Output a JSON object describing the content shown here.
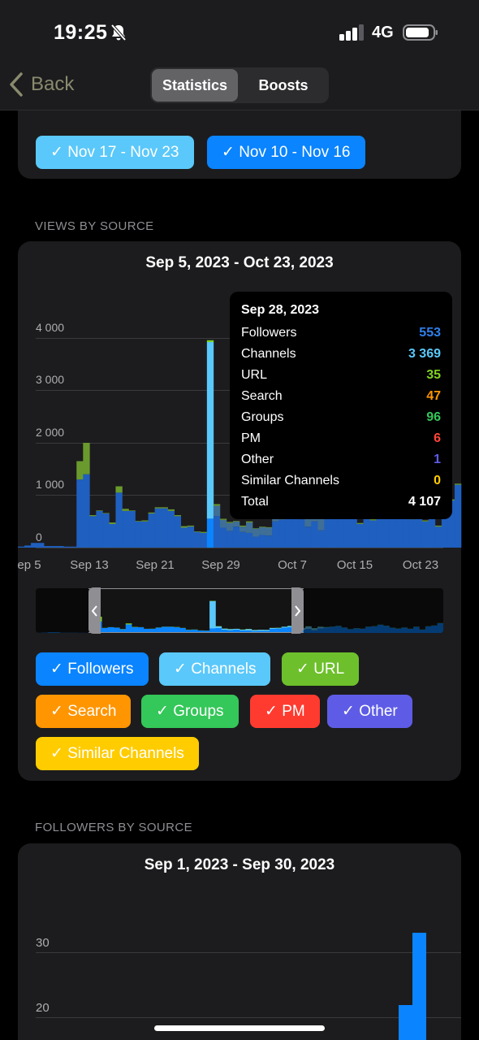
{
  "status": {
    "time": "19:25",
    "network": "4G"
  },
  "nav": {
    "back_label": "Back",
    "tabs": [
      "Statistics",
      "Boosts"
    ]
  },
  "period_chips": [
    {
      "label": "✓ Nov 17 - Nov 23",
      "color": "#5ac8fa"
    },
    {
      "label": "✓ Nov 10 - Nov 16",
      "color": "#0a84ff"
    }
  ],
  "views_section": {
    "title": "VIEWS BY SOURCE",
    "range": "Sep 5, 2023 - Oct 23, 2023",
    "y_ticks": [
      "4 000",
      "3 000",
      "2 000",
      "1 000",
      "0"
    ],
    "x_ticks": [
      "ep 5",
      "Sep 13",
      "Sep 21",
      "Sep 29",
      "Oct 7",
      "Oct 15",
      "Oct 23"
    ],
    "tooltip": {
      "date": "Sep 28, 2023",
      "rows": [
        {
          "label": "Followers",
          "value": "553",
          "color": "#2f80ed"
        },
        {
          "label": "Channels",
          "value": "3 369",
          "color": "#5ac8fa"
        },
        {
          "label": "URL",
          "value": "35",
          "color": "#7ed321"
        },
        {
          "label": "Search",
          "value": "47",
          "color": "#ff9500"
        },
        {
          "label": "Groups",
          "value": "96",
          "color": "#34c759"
        },
        {
          "label": "PM",
          "value": "6",
          "color": "#ff453a"
        },
        {
          "label": "Other",
          "value": "1",
          "color": "#5e5ce6"
        },
        {
          "label": "Similar Channels",
          "value": "0",
          "color": "#ffcc00"
        },
        {
          "label": "Total",
          "value": "4 107",
          "color": "#ffffff"
        }
      ]
    },
    "legend": [
      {
        "label": "✓ Followers",
        "color": "#0a84ff"
      },
      {
        "label": "✓ Channels",
        "color": "#5ac8fa"
      },
      {
        "label": "✓ URL",
        "color": "#6dc02b"
      },
      {
        "label": "✓ Search",
        "color": "#ff9500"
      },
      {
        "label": "✓ Groups",
        "color": "#34c759"
      },
      {
        "label": "✓ PM",
        "color": "#ff3b30"
      },
      {
        "label": "✓ Other",
        "color": "#5e5ce6"
      },
      {
        "label": "✓ Similar Channels",
        "color": "#ffcc00"
      }
    ]
  },
  "followers_section": {
    "title": "FOLLOWERS BY SOURCE",
    "range": "Sep 1, 2023 - Sep 30, 2023",
    "y_ticks": [
      "30",
      "20"
    ]
  },
  "chart_data": {
    "type": "bar",
    "stacked": true,
    "title": "Sep 5, 2023 - Oct 23, 2023",
    "ylim": [
      0,
      4100
    ],
    "x_ticks": [
      "ep 5",
      "Sep 13",
      "Sep 21",
      "Sep 29",
      "Oct 7",
      "Oct 15",
      "Oct 23"
    ],
    "series": [
      {
        "name": "Followers",
        "color": "#1f5fbf",
        "values": [
          20,
          40,
          90,
          90,
          30,
          30,
          30,
          20,
          20,
          1300,
          1400,
          600,
          700,
          650,
          450,
          1050,
          700,
          700,
          500,
          500,
          650,
          750,
          750,
          700,
          600,
          380,
          400,
          300,
          280,
          553,
          600,
          380,
          320,
          400,
          300,
          280,
          210,
          240,
          230,
          500,
          530,
          650,
          700,
          540,
          400,
          500,
          330,
          550,
          650,
          780,
          850,
          650,
          450,
          580,
          520,
          760,
          820,
          1000,
          880,
          640,
          540,
          650,
          500,
          750,
          400,
          800,
          900,
          1200
        ]
      },
      {
        "name": "Channels",
        "color": "#3f6f96",
        "values": [
          0,
          0,
          0,
          0,
          0,
          0,
          0,
          0,
          0,
          0,
          0,
          0,
          0,
          0,
          0,
          0,
          0,
          0,
          0,
          0,
          0,
          0,
          0,
          0,
          0,
          0,
          0,
          0,
          0,
          3369,
          200,
          150,
          150,
          100,
          100,
          200,
          150,
          150,
          150,
          100,
          100,
          100,
          150,
          100,
          200,
          300,
          250,
          200,
          50,
          0,
          0,
          0,
          0,
          0,
          0,
          0,
          0,
          0,
          0,
          0,
          0,
          0,
          0,
          0,
          0,
          0,
          0,
          0
        ]
      },
      {
        "name": "URL",
        "color": "#6a9a2e",
        "values": [
          0,
          0,
          0,
          0,
          0,
          0,
          0,
          0,
          0,
          350,
          600,
          20,
          10,
          10,
          30,
          120,
          40,
          10,
          10,
          20,
          20,
          20,
          20,
          30,
          20,
          30,
          20,
          10,
          20,
          35,
          30,
          20,
          20,
          10,
          20,
          20,
          10,
          10,
          10,
          20,
          20,
          20,
          20,
          20,
          20,
          20,
          20,
          20,
          20,
          20,
          20,
          20,
          20,
          20,
          20,
          20,
          20,
          20,
          20,
          20,
          20,
          20,
          20,
          20,
          20,
          20,
          20,
          20
        ]
      },
      {
        "name": "Search",
        "color": "#ff9500",
        "values": []
      },
      {
        "name": "Groups",
        "color": "#34c759",
        "values": []
      },
      {
        "name": "PM",
        "color": "#ff3b30",
        "values": []
      },
      {
        "name": "Other",
        "color": "#5e5ce6",
        "values": []
      },
      {
        "name": "Similar Channels",
        "color": "#ffcc00",
        "values": []
      }
    ],
    "selected": {
      "date": "Sep 28, 2023",
      "index": 29
    }
  }
}
